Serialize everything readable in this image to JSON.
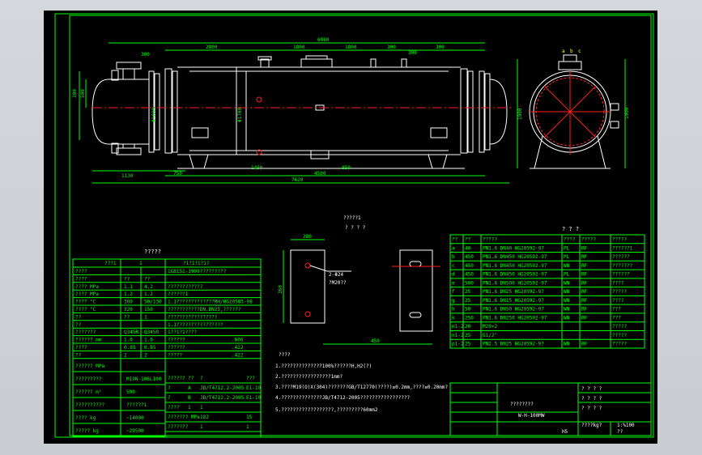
{
  "views": {
    "front_dims": {
      "total_length": "6980",
      "seg_a": "2800",
      "seg_b": "1800",
      "seg_c": "1800",
      "seg_d": "300",
      "seg_e": "300",
      "nozzle_top_a": "300",
      "nozzle_top_b": "300",
      "bottom_left": "1130",
      "bottom_a": "750",
      "bottom_b": "1450",
      "bottom_c": "4500",
      "bottom_d": "850",
      "bottom_total": "7620",
      "left_dia": "Φ1600",
      "shell_dia": "Φ1700",
      "left_h_a": "300",
      "left_h_b": "500",
      "right_height": "1900"
    },
    "support_detail": {
      "title_a": "?????1",
      "title_b": "? ? ? ?",
      "dim_top": "280",
      "dim_side": "360",
      "hole_note_a": "2-Φ24",
      "hole_note_b": "?M20??",
      "dim_bottom": "450"
    },
    "side_view": {
      "top_labels": [
        "a",
        "b",
        "c"
      ],
      "height": "1900"
    }
  },
  "tech_table": {
    "title": "?????",
    "header": [
      "???1",
      "1",
      "?1?1?1?1?"
    ],
    "rows": [
      [
        "????",
        "",
        "",
        "1GB151-1999?????????"
      ],
      [
        "????",
        "??",
        "??",
        ""
      ],
      [
        "???? MPa",
        "1.1",
        "4.2",
        "????????????"
      ],
      [
        "???? MPa",
        "1.2",
        "1.2",
        "??????1"
      ],
      [
        "???? °C",
        "300",
        "50/130",
        "1.1?????????????MH/HG20583-98"
      ],
      [
        "???? °C",
        "320",
        "150",
        "???????????DN.DN25,??????"
      ],
      [
        "??",
        "??",
        "1",
        "?????????????????"
      ],
      [
        "??",
        "",
        "",
        "1.1????????????????"
      ],
      [
        "???????",
        "Q345R",
        "Q345R",
        "1??1?1????"
      ],
      [
        "?????? mm",
        "1.0",
        "1.0",
        "??????",
        ".606"
      ],
      [
        "????",
        "0.85",
        "0.85",
        "??????",
        ".422"
      ],
      [
        "??",
        "2",
        "2",
        "?????",
        ".422"
      ]
    ],
    "lower_rows": [
      [
        "?????? MPa",
        "",
        ""
      ],
      [
        "?????????",
        "M19N-106L100",
        ""
      ],
      [
        "?????? m²",
        "590",
        ""
      ],
      [
        "??????????",
        "??????1",
        ""
      ],
      [
        "???? kg",
        "~14000",
        ""
      ],
      [
        "????? kg",
        "~29500",
        ""
      ]
    ],
    "right_lower": [
      [
        "??????",
        "??",
        "?",
        "???"
      ],
      [
        "?",
        "A",
        "JB/T4712.2-2005",
        "E1-10"
      ],
      [
        "?",
        "B",
        "JB/T4712.2-2005",
        "E1-10"
      ],
      [
        "????",
        "1",
        "1",
        ""
      ],
      [
        "??????? MPa",
        "",
        "182",
        "15"
      ],
      [
        "???????",
        "",
        "1",
        "1"
      ]
    ]
  },
  "nozzle_table": {
    "title": "? ? ?",
    "header": [
      "??",
      "??",
      "?????",
      "????",
      "?????",
      "?????"
    ],
    "rows": [
      [
        "a",
        "40",
        "PN1.6  DN40  HG20592-97",
        "PL",
        "RF",
        "??????1"
      ],
      [
        "b",
        "450",
        "PN1.6  DN450 HG20592-97",
        "PL",
        "RF",
        "??????"
      ],
      [
        "c",
        "450",
        "PN1.6  DN450 HG20592-97",
        "WN",
        "RF",
        "???????"
      ],
      [
        "d",
        "450",
        "PN1.6  DN450 HG20592-97",
        "PL",
        "RF",
        "??????"
      ],
      [
        "e",
        "500",
        "PN1.6  DN500 HG20592-97",
        "WN",
        "RF",
        "????"
      ],
      [
        "f",
        "25",
        "PN1.6  DN25 HG20592-97",
        "WN",
        "RF",
        "?????"
      ],
      [
        "g",
        "25",
        "PN1.6  DN15  HG20592-97",
        "WN",
        "RF",
        "????"
      ],
      [
        "h",
        "50",
        "PN1.6  DN50  HG20592-97",
        "WN",
        "RF",
        "???"
      ],
      [
        "k",
        "250",
        "PN1.6  DN250 HG20592-97",
        "WN",
        "RF",
        "???"
      ],
      [
        "m1-2",
        "20",
        "M20×2",
        "",
        "",
        "?????"
      ],
      [
        "n1-2",
        "25",
        "G1/2\"",
        "",
        "",
        "?????"
      ],
      [
        "p1-2",
        "25",
        "PN2.5  DN25  HG20592-97",
        "WN",
        "RF",
        "?????"
      ]
    ]
  },
  "notes": {
    "title": "????",
    "items": [
      "1.??????????????100%??????H,H2(?)",
      "2.?????????????????1mm?",
      "3.????M19(O)X(304)???????GB/T12770(????)≥0.2mm,????≥0.20mm?",
      "4.??????????????JB/T4712-2005?????????????????",
      "5.??????????????????,?????????60mm2"
    ]
  },
  "title_block": {
    "drawing_name": "????????",
    "model": "W-H-100MW",
    "weight_label": "????kg?",
    "scale": "1:%100",
    "sheet": "??",
    "mark": "H5",
    "small": [
      "? ? ? ?",
      "? ? ? ?",
      "? ? ? ?"
    ]
  }
}
